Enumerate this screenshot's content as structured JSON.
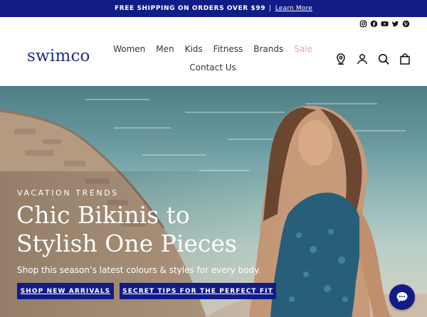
{
  "announcement": {
    "text": "FREE SHIPPING ON ORDERS OVER $99",
    "separator": "|",
    "link": "Learn More"
  },
  "social": [
    "instagram-icon",
    "facebook-icon",
    "youtube-icon",
    "twitter-icon",
    "pinterest-icon"
  ],
  "brand": {
    "logo": "swimco",
    "color": "#1d2c8c"
  },
  "nav": {
    "items": [
      "Women",
      "Men",
      "Kids",
      "Fitness",
      "Brands",
      "Sale"
    ],
    "second_row": [
      "Contact Us"
    ]
  },
  "tools": [
    "location-icon",
    "account-icon",
    "search-icon",
    "cart-icon"
  ],
  "hero": {
    "eyebrow": "VACATION TRENDS",
    "headline_line1": "Chic Bikinis to",
    "headline_line2": "Stylish One Pieces",
    "subtext": "Shop this season’s latest colours & styles for every body.",
    "button1": "SHOP NEW ARRIVALS",
    "button2": "SECRET TIPS FOR THE PERFECT FIT"
  },
  "colors": {
    "primary": "#111c86",
    "sale": "#e8a3b6"
  }
}
